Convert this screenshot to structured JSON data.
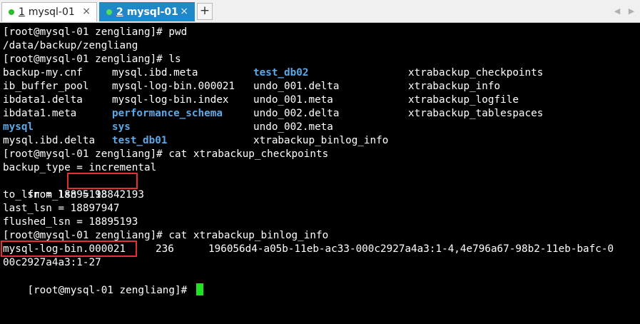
{
  "tabs": [
    {
      "num": "1",
      "label": "mysql-01",
      "close": "×"
    },
    {
      "num": "2",
      "label": "mysql-01",
      "close": "×"
    }
  ],
  "add_tab": "+",
  "nav": {
    "left": "◀",
    "right": "▶"
  },
  "terminal": {
    "cmd1": "[root@mysql-01 zengliang]# pwd",
    "out1": "/data/backup/zengliang",
    "cmd2": "[root@mysql-01 zengliang]# ls",
    "ls": {
      "col1": [
        "backup-my.cnf",
        "ib_buffer_pool",
        "ibdata1.delta",
        "ibdata1.meta",
        "mysql",
        "mysql.ibd.delta"
      ],
      "col2": [
        "mysql.ibd.meta",
        "mysql-log-bin.000021",
        "mysql-log-bin.index",
        "performance_schema",
        "sys",
        "test_db01"
      ],
      "col3": [
        "test_db02",
        "undo_001.delta",
        "undo_001.meta",
        "undo_002.delta",
        "undo_002.meta",
        "xtrabackup_binlog_info"
      ],
      "col4": [
        "xtrabackup_checkpoints",
        "xtrabackup_info",
        "xtrabackup_logfile",
        "xtrabackup_tablespaces"
      ]
    },
    "cmd3": "[root@mysql-01 zengliang]# cat xtrabackup_checkpoints",
    "cp1": "backup_type = incremental",
    "cp2_key": "from_lsn = ",
    "cp2_val": "18842193",
    "cp3": "to_lsn = 18895193",
    "cp4": "last_lsn = 18897947",
    "cp5": "flushed_lsn = 18895193",
    "cmd4": "[root@mysql-01 zengliang]# cat xtrabackup_binlog_info",
    "bl_file": "mysql-log-bin.000021",
    "bl_pos": "236",
    "bl_gtid1": "196056d4-a05b-11eb-ac33-000c2927a4a3:1-4,4e796a67-98b2-11eb-bafc-0",
    "bl_gtid2": "00c2927a4a3:1-27",
    "prompt": "[root@mysql-01 zengliang]# "
  },
  "colors": {
    "directory": "#5aa9e8",
    "highlight_box": "#e53030",
    "cursor": "#22e022",
    "active_tab": "#1e88c8"
  }
}
